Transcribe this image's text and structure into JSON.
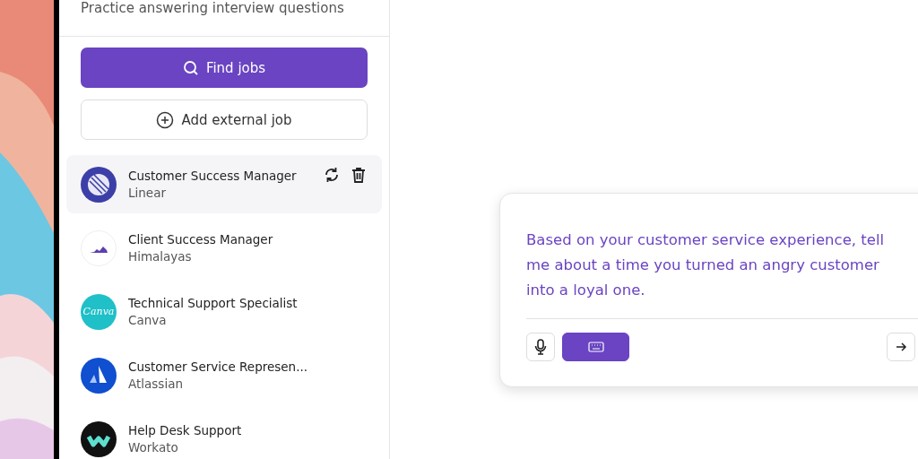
{
  "sidebar": {
    "subtitle": "Practice answering interview questions",
    "buttons": [
      {
        "kind": "primary",
        "label": "Find jobs"
      },
      {
        "kind": "secondary",
        "label": "Add external job"
      }
    ],
    "jobs": [
      {
        "kind": "linear",
        "title": "Customer Success Manager",
        "company": "Linear",
        "selected": true
      },
      {
        "kind": "himalayas",
        "title": "Client Success Manager",
        "company": "Himalayas",
        "selected": false
      },
      {
        "kind": "canva",
        "title": "Technical Support Specialist",
        "company": "Canva",
        "logo_text": "Canva",
        "selected": false
      },
      {
        "kind": "atlassian",
        "title": "Customer Service Represen...",
        "company": "Atlassian",
        "selected": false
      },
      {
        "kind": "workato",
        "title": "Help Desk Support",
        "company": "Workato",
        "selected": false
      }
    ]
  },
  "question_card": {
    "question": "Based on your customer service experience, tell me about a time you turned an angry customer into a loyal one.",
    "input_modes": [
      {
        "kind": "voice",
        "selected": false
      },
      {
        "kind": "keyboard",
        "selected": true
      }
    ]
  }
}
